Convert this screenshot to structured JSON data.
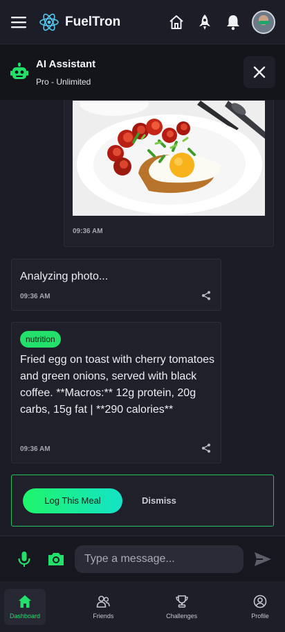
{
  "app": {
    "title": "FuelTron"
  },
  "assistant": {
    "name": "AI Assistant",
    "plan": "Pro - Unlimited"
  },
  "messages": {
    "user_photo": {
      "time": "09:36 AM"
    },
    "analyzing": {
      "text": "Analyzing photo...",
      "time": "09:36 AM"
    },
    "result": {
      "tag": "nutrition",
      "text": "Fried egg on toast with cherry tomatoes and green onions, served with black coffee. **Macros:** 12g protein, 20g carbs, 15g fat | **290 calories**",
      "time": "09:36 AM"
    }
  },
  "meal_actions": {
    "log_label": "Log This Meal",
    "dismiss_label": "Dismiss"
  },
  "composer": {
    "placeholder": "Type a message..."
  },
  "nav": {
    "items": [
      {
        "label": "Dashboard",
        "icon": "home-icon"
      },
      {
        "label": "Friends",
        "icon": "friends-icon"
      },
      {
        "label": "Challenges",
        "icon": "trophy-icon"
      },
      {
        "label": "Profile",
        "icon": "profile-icon"
      }
    ]
  },
  "colors": {
    "accent": "#22e06a",
    "background": "#1b1c25",
    "card": "#1f2029"
  },
  "icons": [
    "menu-icon",
    "react-logo-icon",
    "home-icon",
    "rocket-icon",
    "bell-icon",
    "robot-icon",
    "close-icon",
    "share-icon",
    "mic-icon",
    "camera-icon",
    "send-icon"
  ]
}
